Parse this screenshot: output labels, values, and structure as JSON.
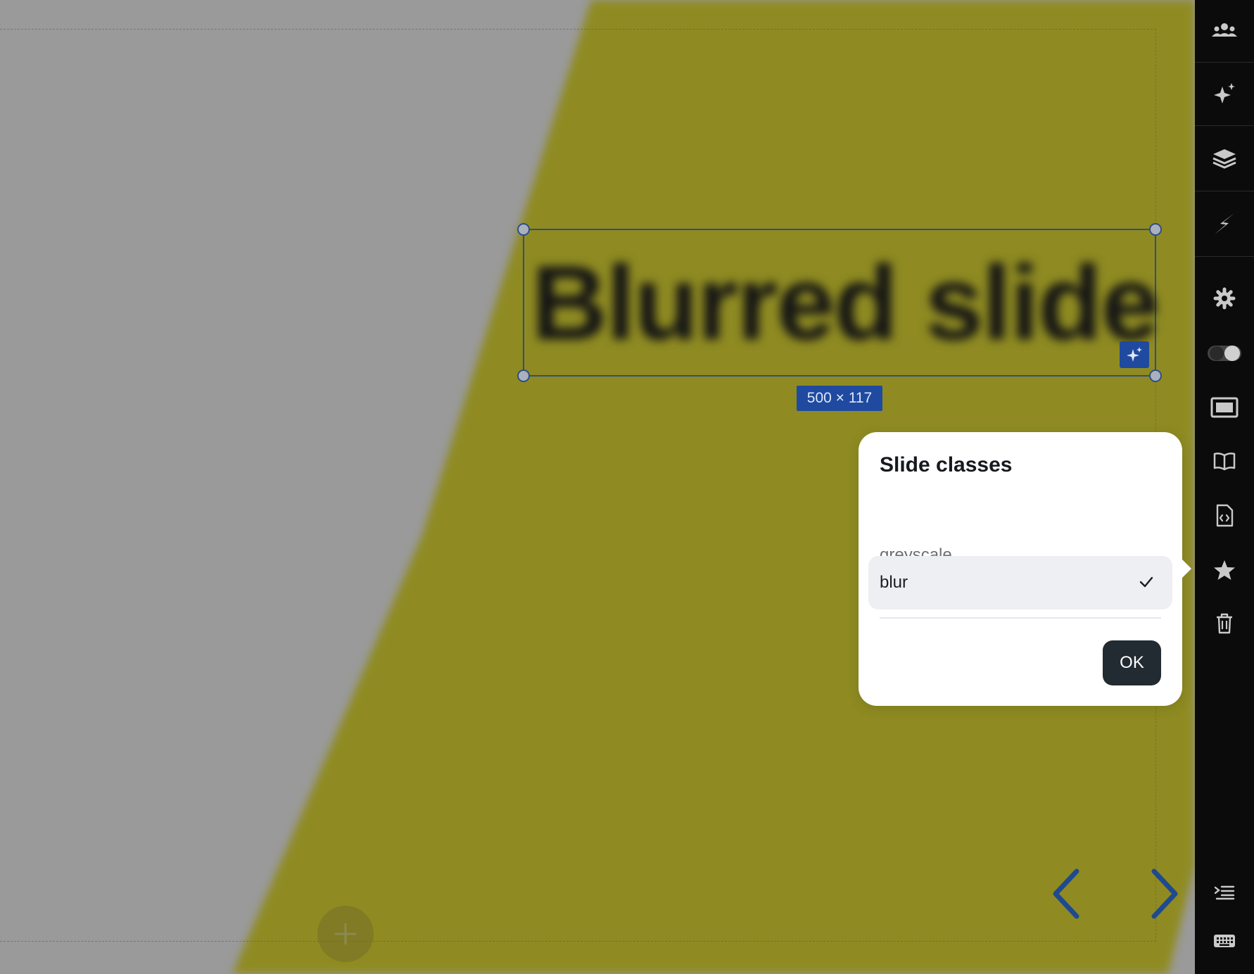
{
  "slide": {
    "heading": "Blurred slide",
    "dimensions": "500 × 117",
    "colors": {
      "background": "#9a9a9a",
      "accent_shape": "#8f8b22"
    }
  },
  "popover": {
    "title": "Slide classes",
    "options": [
      {
        "label": "greyscale",
        "selected": false
      },
      {
        "label": "blur",
        "selected": true
      }
    ],
    "ok_label": "OK"
  },
  "toolbar": {
    "icons": [
      "people-icon",
      "sparkle-icon",
      "layers-icon",
      "lightning-icon",
      "gear-icon",
      "toggle-icon",
      "present-icon",
      "book-icon",
      "code-file-icon",
      "star-icon",
      "trash-icon",
      "outline-icon",
      "keyboard-icon"
    ]
  },
  "navigation": {
    "prev": "chevron-left-icon",
    "next": "chevron-right-icon",
    "add": "plus-icon"
  }
}
